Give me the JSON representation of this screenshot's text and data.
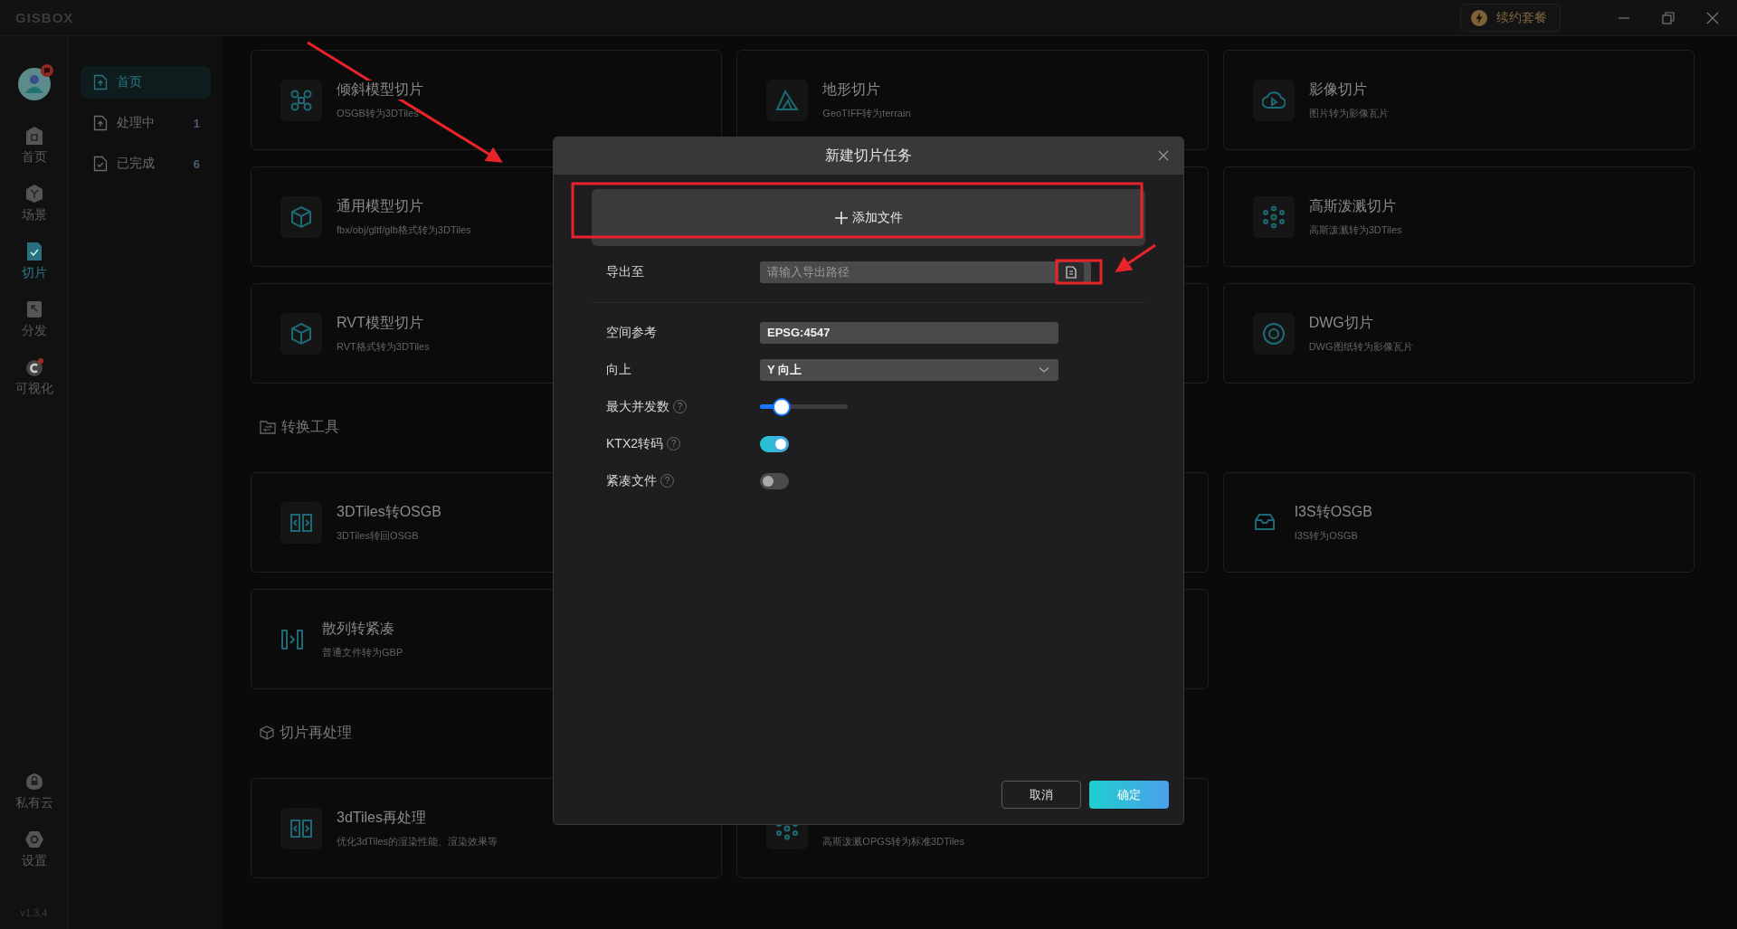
{
  "header": {
    "logo": "GISBOX",
    "renew_button": "续约套餐"
  },
  "rail": {
    "items": [
      {
        "label": "首页",
        "selected": false
      },
      {
        "label": "场景",
        "selected": false
      },
      {
        "label": "切片",
        "selected": true
      },
      {
        "label": "分发",
        "selected": false
      },
      {
        "label": "可视化",
        "selected": false
      }
    ],
    "bottom_items": [
      {
        "label": "私有云",
        "selected": false
      },
      {
        "label": "设置",
        "selected": false
      }
    ],
    "version": "v1.3.4"
  },
  "sidebar": {
    "items": [
      {
        "label": "首页",
        "selected": true
      },
      {
        "label": "处理中",
        "count": "1",
        "selected": false
      },
      {
        "label": "已完成",
        "count": "6",
        "selected": false
      }
    ]
  },
  "sections": [
    {
      "cards": [
        {
          "kind": "full",
          "title": "倾斜模型切片",
          "subtitle": "OSGB转为3DTiles"
        },
        {
          "kind": "full",
          "title": "地形切片",
          "subtitle": "GeoTIFF转为terrain"
        },
        {
          "kind": "full",
          "title": "影像切片",
          "subtitle": "图片转为影像瓦片"
        },
        {
          "kind": "full",
          "title": "通用模型切片",
          "subtitle": "fbx/obj/gltf/glb格式转为3DTiles"
        },
        {
          "kind": "covered"
        },
        {
          "kind": "full",
          "title": "高斯泼溅切片",
          "subtitle": "高斯泼溅转为3DTiles"
        },
        {
          "kind": "full",
          "title": "RVT模型切片",
          "subtitle": "RVT格式转为3DTiles"
        },
        {
          "kind": "covered"
        },
        {
          "kind": "full",
          "title": "DWG切片",
          "subtitle": "DWG图纸转为影像瓦片"
        }
      ]
    },
    {
      "title": "转换工具",
      "cards": [
        {
          "kind": "full",
          "title": "3DTiles转OSGB",
          "subtitle": "3DTiles转回OSGB"
        },
        {
          "kind": "covered"
        },
        {
          "kind": "full",
          "title": "I3S转OSGB",
          "subtitle": "I3S转为OSGB"
        },
        {
          "kind": "full",
          "title": "散列转紧凑",
          "subtitle": "普通文件转为GBP"
        },
        {
          "kind": "covered"
        }
      ]
    },
    {
      "title": "切片再处理",
      "cards": [
        {
          "kind": "full",
          "title": "3dTiles再处理",
          "subtitle": "优化3dTiles的渲染性能、渲染效果等"
        },
        {
          "kind": "partial",
          "subtitle": "高斯泼溅OPGS转为标准3DTiles"
        }
      ]
    }
  ],
  "dialog": {
    "title": "新建切片任务",
    "add_file_button": "添加文件",
    "fields": [
      {
        "kind": "path",
        "label": "导出至",
        "placeholder": "请输入导出路径"
      },
      {
        "kind": "text",
        "label": "空间参考",
        "value": "EPSG:4547"
      },
      {
        "kind": "select",
        "label": "向上",
        "value": "Y 向上"
      },
      {
        "kind": "slider",
        "label": "最大并发数",
        "help": "?",
        "level": 0.23
      },
      {
        "kind": "switch",
        "label": "KTX2转码",
        "help": "?",
        "on": true
      },
      {
        "kind": "switch",
        "label": "紧凑文件",
        "help": "?",
        "on": false
      }
    ],
    "buttons": [
      {
        "label": "取消",
        "kind": "secondary"
      },
      {
        "label": "确定",
        "kind": "primary"
      }
    ]
  }
}
